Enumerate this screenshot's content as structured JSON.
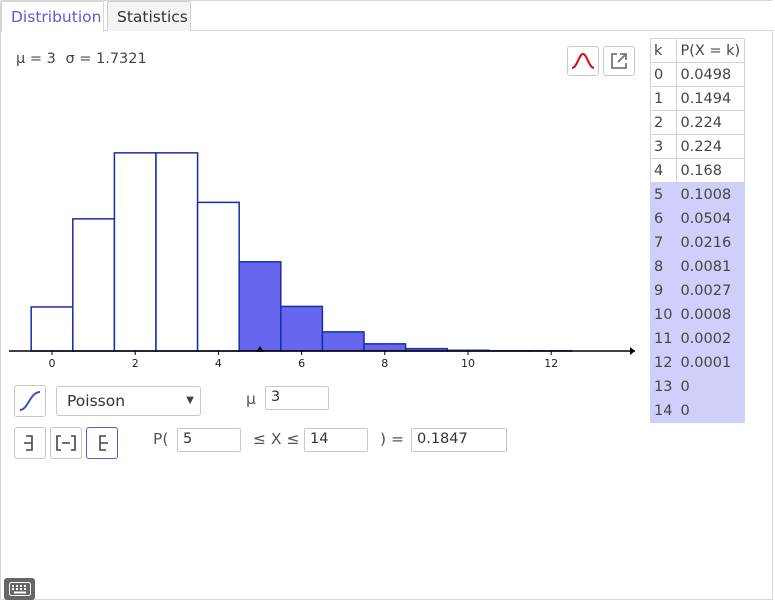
{
  "tabs": [
    {
      "label": "Distribution",
      "active": true
    },
    {
      "label": "Statistics",
      "active": false
    }
  ],
  "stats": {
    "mu_text": "μ = 3",
    "sigma_text": "σ = 1.7321"
  },
  "toolbar": {
    "normal_overlay_icon": "normal-curve-icon",
    "export_icon": "export-icon"
  },
  "chart_data": {
    "type": "bar",
    "distribution": "Poisson",
    "x": [
      0,
      1,
      2,
      3,
      4,
      5,
      6,
      7,
      8,
      9,
      10,
      11,
      12,
      13,
      14
    ],
    "values": [
      0.0498,
      0.1494,
      0.224,
      0.224,
      0.168,
      0.1008,
      0.0504,
      0.0216,
      0.0081,
      0.0027,
      0.0008,
      0.0002,
      0.0001,
      0,
      0
    ],
    "highlighted_range": [
      5,
      14
    ],
    "xticks": [
      "0",
      "2",
      "4",
      "6",
      "8",
      "10",
      "12"
    ],
    "xlim": [
      -1,
      14
    ],
    "ylim": [
      0,
      0.26
    ],
    "marker_x": 5,
    "colors": {
      "bar_outline": "#1a2ea8",
      "bar_highlight": "#6666ee",
      "axis": "#000000"
    }
  },
  "table": {
    "headers": [
      "k",
      "P(X = k)"
    ],
    "rows": [
      {
        "k": "0",
        "p": "0.0498",
        "hl": false
      },
      {
        "k": "1",
        "p": "0.1494",
        "hl": false
      },
      {
        "k": "2",
        "p": "0.224",
        "hl": false
      },
      {
        "k": "3",
        "p": "0.224",
        "hl": false
      },
      {
        "k": "4",
        "p": "0.168",
        "hl": false
      },
      {
        "k": "5",
        "p": "0.1008",
        "hl": true
      },
      {
        "k": "6",
        "p": "0.0504",
        "hl": true
      },
      {
        "k": "7",
        "p": "0.0216",
        "hl": true
      },
      {
        "k": "8",
        "p": "0.0081",
        "hl": true
      },
      {
        "k": "9",
        "p": "0.0027",
        "hl": true
      },
      {
        "k": "10",
        "p": "0.0008",
        "hl": true
      },
      {
        "k": "11",
        "p": "0.0002",
        "hl": true
      },
      {
        "k": "12",
        "p": "0.0001",
        "hl": true
      },
      {
        "k": "13",
        "p": "0",
        "hl": true
      },
      {
        "k": "14",
        "p": "0",
        "hl": true
      }
    ]
  },
  "controls": {
    "distribution_value": "Poisson",
    "param_label": "μ",
    "param_value": "3",
    "p_open": "P(",
    "low_value": "5",
    "le_x_le": "≤ X ≤",
    "high_value": "14",
    "close_eq": ") =",
    "result_value": "0.1847",
    "interval_selected": "right-sided"
  }
}
